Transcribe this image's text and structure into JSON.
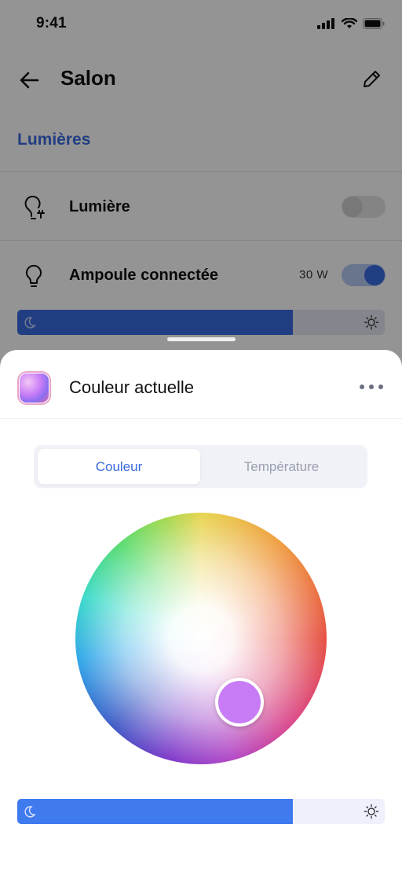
{
  "status_bar": {
    "time": "9:41"
  },
  "nav": {
    "title": "Salon"
  },
  "section": {
    "title": "Lumières"
  },
  "devices": [
    {
      "label": "Lumière",
      "watt": "",
      "on": false
    },
    {
      "label": "Ampoule connectée",
      "watt": "30 W",
      "on": true
    }
  ],
  "device_brightness": 0.75,
  "sheet": {
    "title": "Couleur actuelle",
    "tabs": [
      {
        "label": "Couleur",
        "active": true
      },
      {
        "label": "Température",
        "active": false
      }
    ],
    "selected_color": "#c77cf6",
    "brightness": 0.75
  },
  "colors": {
    "accent": "#3a6be0",
    "slider": "#3f7aef"
  }
}
